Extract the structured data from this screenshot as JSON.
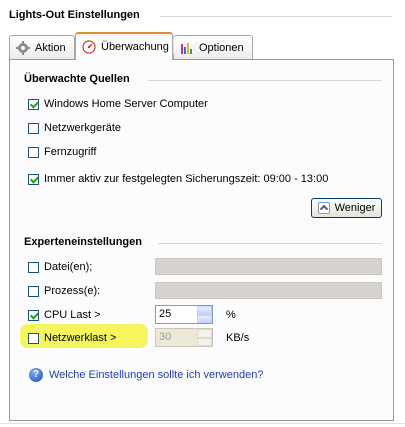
{
  "window": {
    "title": "Lights-Out Einstellungen"
  },
  "tabs": [
    {
      "label": "Aktion",
      "icon": "gear-icon",
      "active": false
    },
    {
      "label": "Überwachung",
      "icon": "gauge-icon",
      "active": true
    },
    {
      "label": "Optionen",
      "icon": "bar-chart-icon",
      "active": false
    }
  ],
  "monitored": {
    "title": "Überwachte Quellen",
    "items": [
      {
        "label": "Windows Home Server Computer",
        "checked": true
      },
      {
        "label": "Netzwerkgeräte",
        "checked": false
      },
      {
        "label": "Fernzugriff",
        "checked": false
      },
      {
        "label": "Immer aktiv zur festgelegten Sicherungszeit: 09:00 - 13:00",
        "checked": true
      }
    ],
    "less_button": "Weniger"
  },
  "expert": {
    "title": "Experteneinstellungen",
    "file_label": "Datei(en);",
    "file_checked": false,
    "process_label": "Prozess(e):",
    "process_checked": false,
    "cpu_label": "CPU Last >",
    "cpu_checked": true,
    "cpu_value": "25",
    "cpu_unit": "%",
    "net_label": "Netzwerklast >",
    "net_checked": false,
    "net_value": "30",
    "net_unit": "KB/s"
  },
  "help": {
    "link": "Welche Einstellungen sollte ich verwenden?"
  },
  "colors": {
    "highlight": "#f5f55e",
    "link": "#1d3fb5",
    "tab_active_accent": "#e68b2c"
  }
}
